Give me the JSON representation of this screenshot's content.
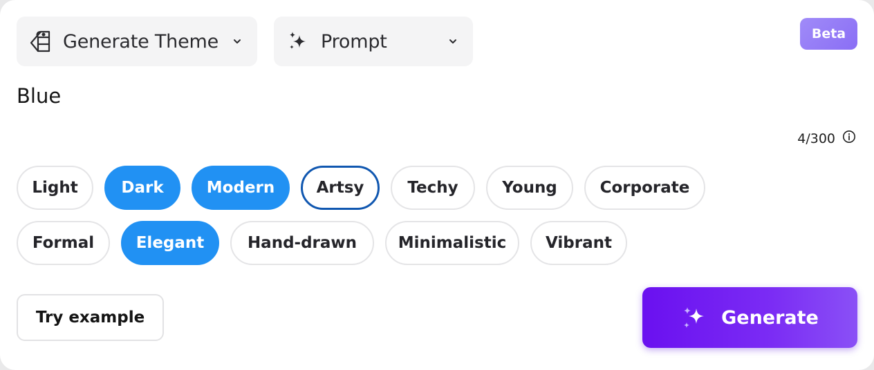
{
  "dropdowns": {
    "mode": {
      "label": "Generate Theme",
      "icon": "eraser-icon"
    },
    "source": {
      "label": "Prompt",
      "icon": "sparkle-icon"
    }
  },
  "badge": {
    "label": "Beta",
    "color": "#9179f7"
  },
  "prompt": {
    "value": "Blue"
  },
  "counter": {
    "text": "4/300",
    "icon": "info-icon"
  },
  "chips": {
    "row1": [
      {
        "label": "Light",
        "selected": false
      },
      {
        "label": "Dark",
        "selected": true
      },
      {
        "label": "Modern",
        "selected": true
      },
      {
        "label": "Artsy",
        "selected": false,
        "focused": true
      },
      {
        "label": "Techy",
        "selected": false
      },
      {
        "label": "Young",
        "selected": false
      },
      {
        "label": "Corporate",
        "selected": false
      }
    ],
    "row2": [
      {
        "label": "Formal",
        "selected": false
      },
      {
        "label": "Elegant",
        "selected": true
      },
      {
        "label": "Hand-drawn",
        "selected": false
      },
      {
        "label": "Minimalistic",
        "selected": false
      },
      {
        "label": "Vibrant",
        "selected": false
      }
    ]
  },
  "actions": {
    "try_example": "Try example",
    "generate": "Generate"
  },
  "colors": {
    "selected_chip": "#2191f3",
    "focus_ring": "#1057b0",
    "generate_button": "#6a10f0"
  }
}
